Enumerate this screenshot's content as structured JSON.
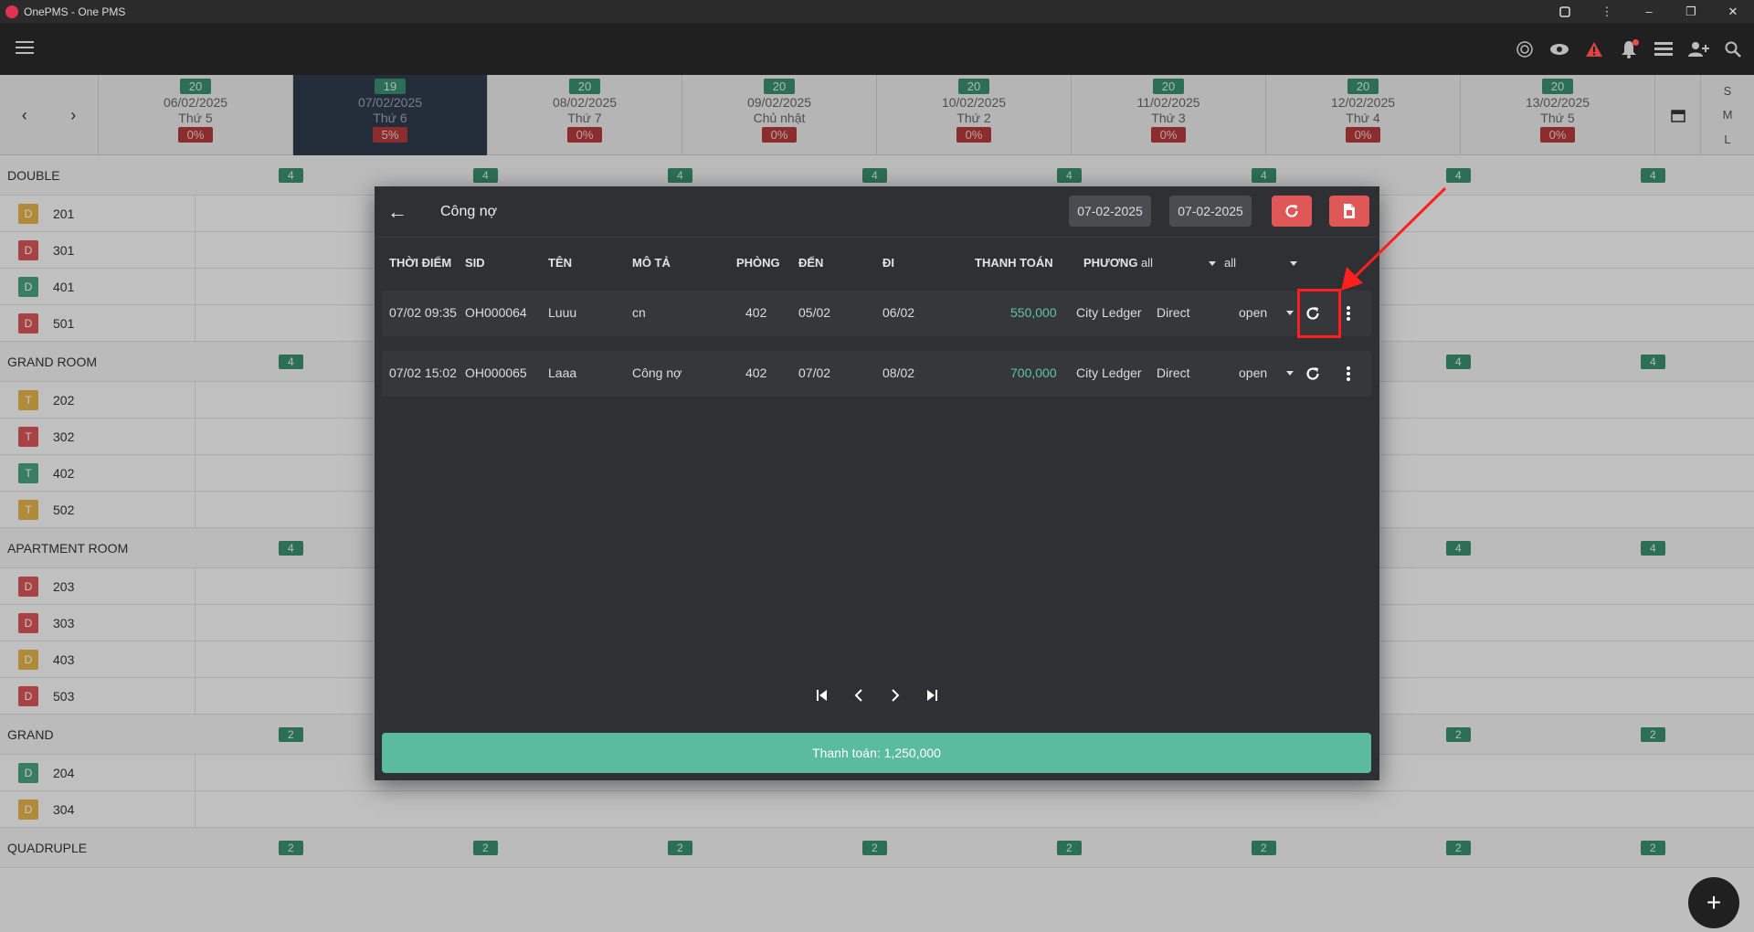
{
  "window": {
    "title": "OnePMS - One PMS"
  },
  "dates": [
    {
      "avail": "20",
      "date": "06/02/2025",
      "day": "Thứ 5",
      "occ": "0%"
    },
    {
      "avail": "19",
      "date": "07/02/2025",
      "day": "Thứ 6",
      "occ": "5%"
    },
    {
      "avail": "20",
      "date": "08/02/2025",
      "day": "Thứ 7",
      "occ": "0%"
    },
    {
      "avail": "20",
      "date": "09/02/2025",
      "day": "Chủ nhật",
      "occ": "0%"
    },
    {
      "avail": "20",
      "date": "10/02/2025",
      "day": "Thứ 2",
      "occ": "0%"
    },
    {
      "avail": "20",
      "date": "11/02/2025",
      "day": "Thứ 3",
      "occ": "0%"
    },
    {
      "avail": "20",
      "date": "12/02/2025",
      "day": "Thứ 4",
      "occ": "0%"
    },
    {
      "avail": "20",
      "date": "13/02/2025",
      "day": "Thứ 5",
      "occ": "0%"
    }
  ],
  "sizes": [
    "S",
    "M",
    "L"
  ],
  "grid": {
    "cat_double": "DOUBLE",
    "cat_grand_room": "GRAND ROOM",
    "cat_apartment": "APARTMENT ROOM",
    "cat_grand": "GRAND",
    "cat_quadruple": "QUADRUPLE",
    "count_4": "4",
    "count_2": "2",
    "room_201": "201",
    "room_301": "301",
    "room_401": "401",
    "room_501": "501",
    "room_202": "202",
    "room_302": "302",
    "room_402": "402",
    "room_502": "502",
    "room_203": "203",
    "room_303": "303",
    "room_403": "403",
    "room_503": "503",
    "room_204": "204",
    "room_304": "304",
    "badge_D": "D",
    "badge_T": "T"
  },
  "dialog": {
    "title": "Công nợ",
    "date_from": "07-02-2025",
    "date_to": "07-02-2025",
    "columns": {
      "time": "THỜI ĐIỂM",
      "sid": "SID",
      "name": "TÊN",
      "desc": "MÔ TẢ",
      "room": "PHÒNG",
      "arrive": "ĐẾN",
      "depart": "ĐI",
      "payment": "THANH TOÁN",
      "method": "PHƯƠNG"
    },
    "filter1": "all",
    "filter2": "all",
    "rows": [
      {
        "time": "07/02 09:35",
        "sid": "OH000064",
        "name": "Luuu",
        "desc": "cn",
        "room": "402",
        "arrive": "05/02",
        "depart": "06/02",
        "amount": "550,000",
        "method": "City Ledger",
        "channel": "Direct",
        "status": "open"
      },
      {
        "time": "07/02 15:02",
        "sid": "OH000065",
        "name": "Laaa",
        "desc": "Công nợ",
        "room": "402",
        "arrive": "07/02",
        "depart": "08/02",
        "amount": "700,000",
        "method": "City Ledger",
        "channel": "Direct",
        "status": "open"
      }
    ],
    "total": "Thanh toán: 1,250,000"
  },
  "colors": {
    "accent": "#5bbb9e",
    "danger": "#e05757",
    "highlight": "#ff1f1f"
  }
}
